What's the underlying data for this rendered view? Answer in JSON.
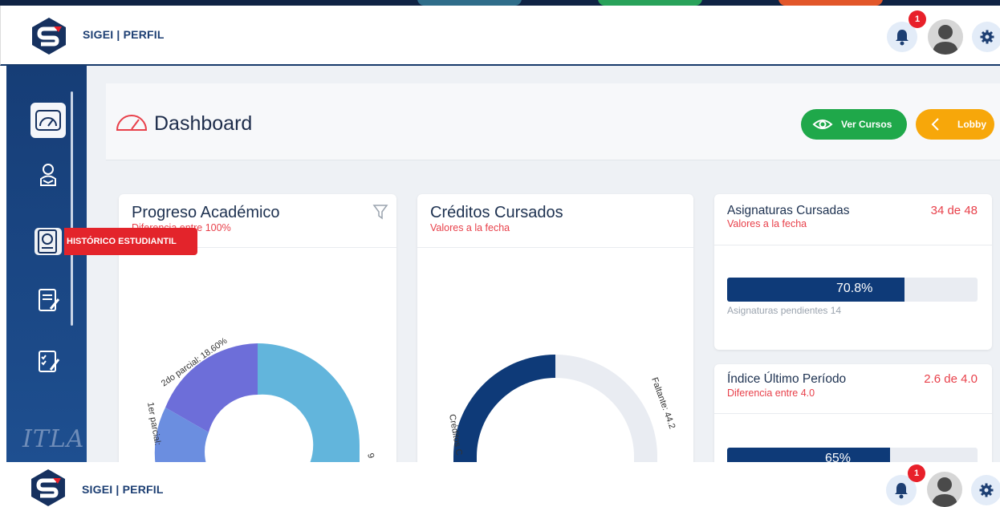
{
  "brand": "SIGEI | PERFIL",
  "notifications_count": "1",
  "sidebar": {
    "items": [
      {
        "name": "dashboard",
        "icon": "speedometer-icon",
        "active": true
      },
      {
        "name": "profile",
        "icon": "student-reading-icon"
      },
      {
        "name": "historico",
        "icon": "student-record-icon"
      },
      {
        "name": "documents",
        "icon": "document-edit-icon"
      },
      {
        "name": "evaluations",
        "icon": "checklist-edit-icon"
      }
    ],
    "tooltip": "HISTÓRICO ESTUDIANTIL",
    "footer_logo": "ITLA"
  },
  "dashboard": {
    "title": "Dashboard",
    "ver_cursos": "Ver Cursos",
    "lobby": "Lobby"
  },
  "progreso": {
    "title": "Progreso Académico",
    "subtitle": "Diferencia entre 100%",
    "labels": {
      "parcial2": "2do parcial: 18.60%",
      "parcial1": "1er parcial: ",
      "other": "9"
    }
  },
  "creditos": {
    "title": "Créditos Cursados",
    "subtitle": "Valores a la fecha",
    "labels": {
      "faltante": "Faltante: 44.2",
      "cursados": "Créditos C"
    }
  },
  "asignaturas": {
    "title": "Asignaturas Cursadas",
    "subtitle": "Valores a la fecha",
    "value": "34 de 48",
    "percent_label": "70.8%",
    "percent": 70.8,
    "pending": "Asignaturas pendientes 14"
  },
  "indice": {
    "title": "Índice Último Período",
    "subtitle": "Diferencia entre 4.0",
    "value": "2.6 de 4.0",
    "percent_label": "65%",
    "percent": 65
  },
  "colors": {
    "green": "#1fa84a",
    "orange": "#f7a70a",
    "navy": "#0e3a78",
    "red": "#e8404a"
  }
}
